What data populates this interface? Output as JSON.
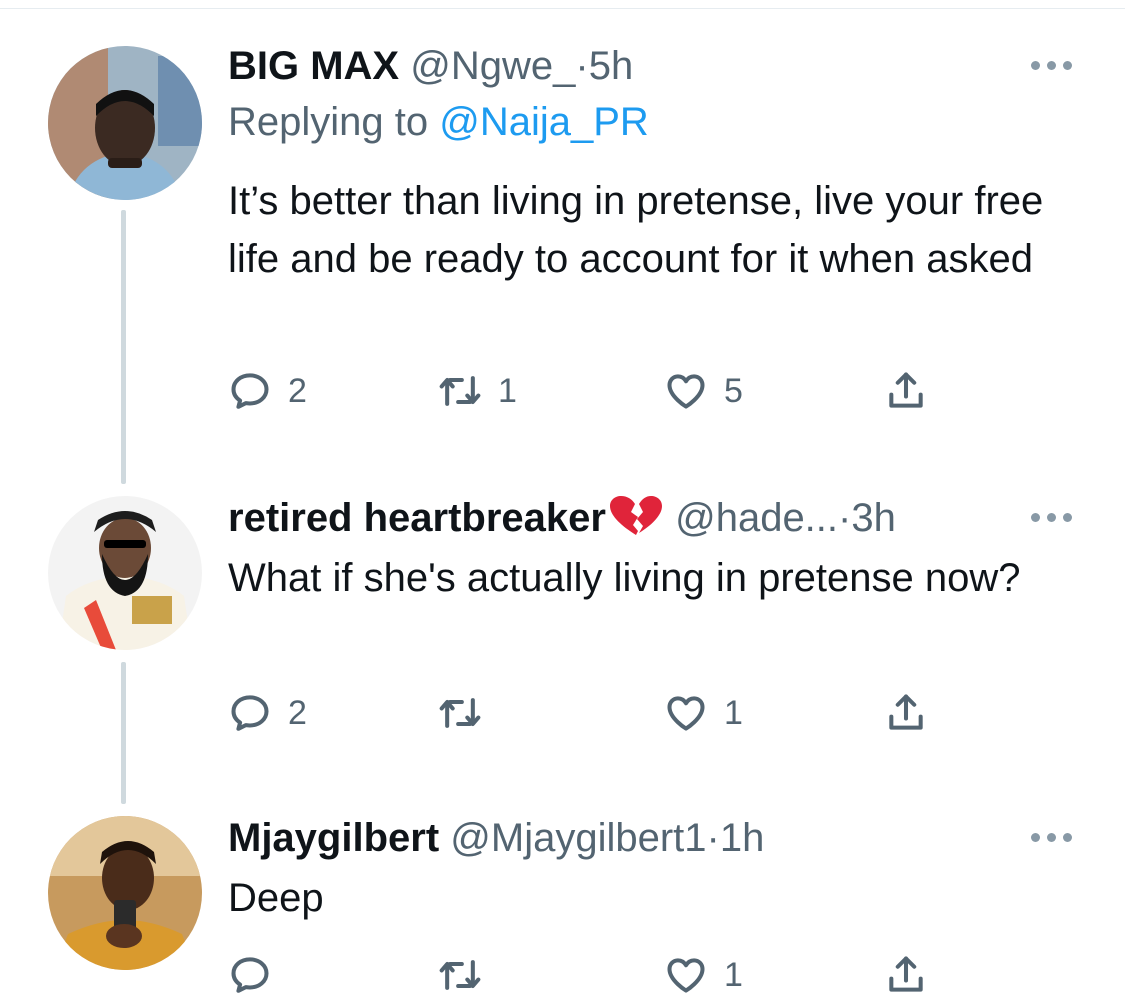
{
  "tweets": [
    {
      "name": "BIG MAX",
      "handle": "@Ngwe_",
      "dot": "·",
      "time": "5h",
      "replying_prefix": "Replying to",
      "replying_mention": "@Naija_PR",
      "text": "It’s better than living in pretense, live your free life and be ready to account for it when asked",
      "actions": {
        "reply": "2",
        "retweet": "1",
        "like": "5"
      }
    },
    {
      "name": "retired heartbreaker",
      "name_emoji": "broken-heart-emoji",
      "handle": "@hade...",
      "dot": "·",
      "time": "3h",
      "text": "What if she's actually living in pretense now?",
      "actions": {
        "reply": "2",
        "retweet": "",
        "like": "1"
      }
    },
    {
      "name": "Mjaygilbert",
      "handle": "@Mjaygilbert1",
      "dot": "·",
      "time": "1h",
      "text": "Deep",
      "actions": {
        "reply": "",
        "retweet": "",
        "like": "1"
      }
    }
  ],
  "icons": {
    "reply": "reply-icon",
    "retweet": "retweet-icon",
    "like": "heart-icon",
    "share": "share-icon",
    "more": "more-icon"
  },
  "colors": {
    "text": "#0f1419",
    "secondary": "#536471",
    "link": "#1d9bf0",
    "thread_line": "#cfd9de",
    "icon": "#536471"
  }
}
